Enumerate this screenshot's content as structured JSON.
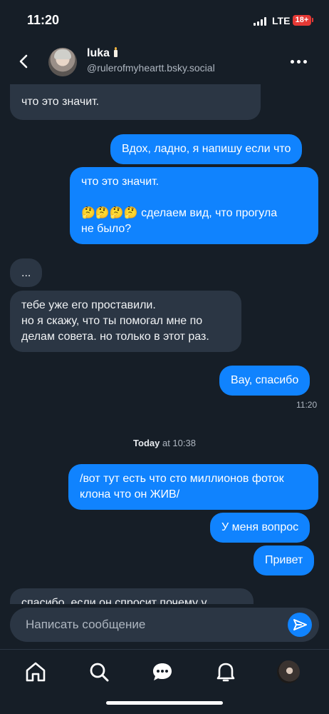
{
  "status_bar": {
    "time": "11:20",
    "network": "LTE",
    "battery_badge": "18+"
  },
  "header": {
    "name": "luka",
    "handle": "@rulerofmyheartt.bsky.social"
  },
  "messages": [
    {
      "direction": "in",
      "text": "что это значит."
    },
    {
      "direction": "out",
      "text": "Вдох, ладно, я напишу если что"
    },
    {
      "direction": "out",
      "text": "что это значит.\n\n🤔🤔🤔🤔 сделаем вид, что прогула\nне было?"
    },
    {
      "direction": "in",
      "text": "..."
    },
    {
      "direction": "in",
      "text": "тебе уже его проставили.\nно я скажу, что ты помогал мне по\nделам совета. но только в этот раз."
    },
    {
      "direction": "out",
      "text": "Вау, спасибо"
    },
    {
      "direction": "out",
      "text": "/вот тут есть что сто миллионов фоток\nклона что он ЖИВ/"
    },
    {
      "direction": "out",
      "text": "У меня вопрос"
    },
    {
      "direction": "out",
      "text": "Привет"
    },
    {
      "direction": "in",
      "text": "спасибо, если он спросит почему у"
    }
  ],
  "timestamps": {
    "after_spasibo": "11:20"
  },
  "day_separator": {
    "day": "Today",
    "rest": " at 10:38"
  },
  "composer": {
    "placeholder": "Написать сообщение"
  },
  "colors": {
    "background": "#161e27",
    "incoming": "#2b3644",
    "outgoing": "#1083fe",
    "battery": "#e53935"
  },
  "icons": [
    "back-chevron-icon",
    "more-icon",
    "send-icon",
    "home-icon",
    "search-icon",
    "chat-icon",
    "bell-icon"
  ]
}
